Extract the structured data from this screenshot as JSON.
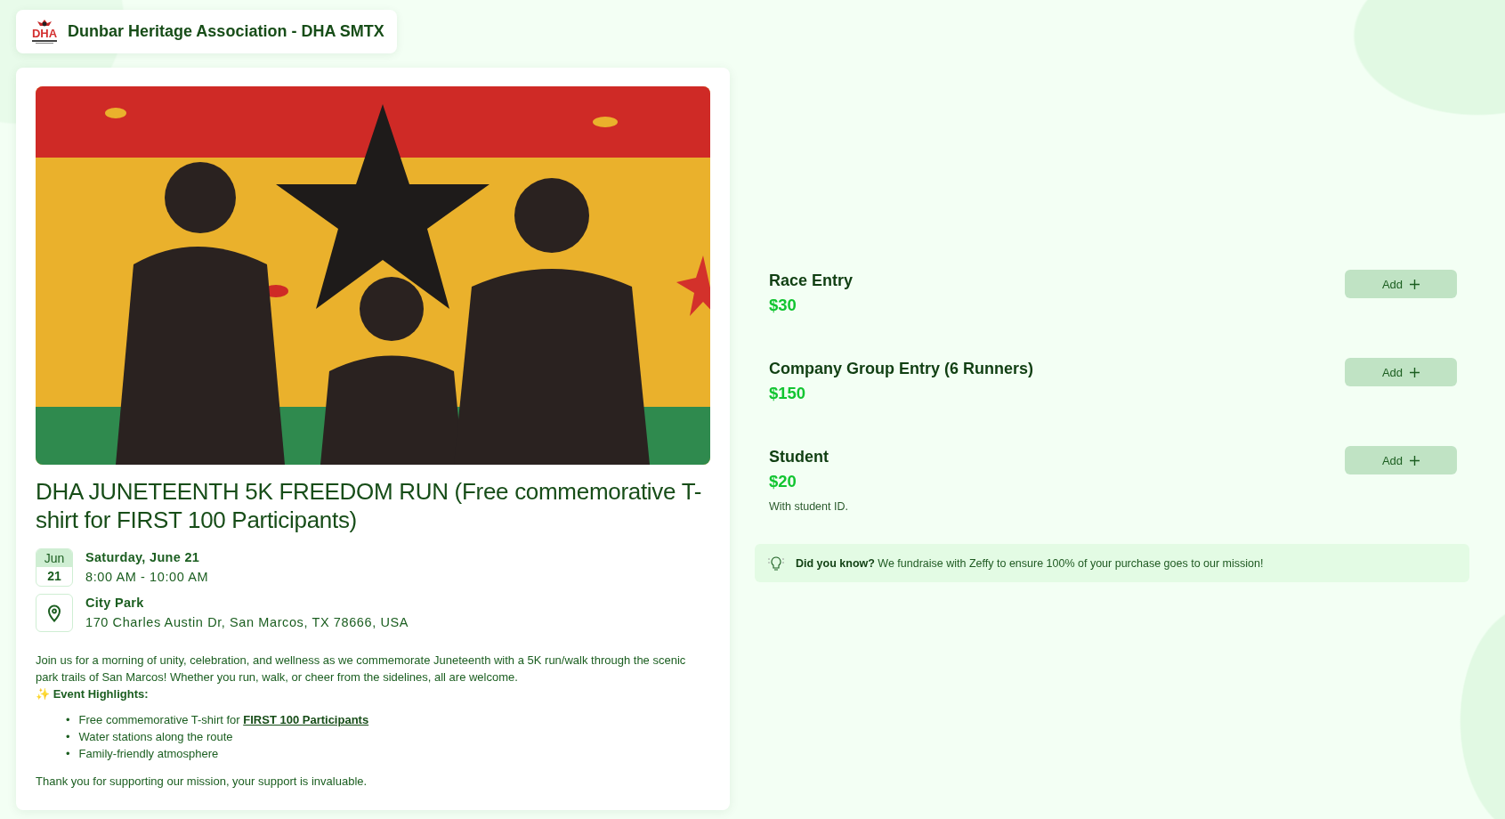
{
  "organization": {
    "name": "Dunbar Heritage Association - DHA SMTX",
    "logo_text": "DHA"
  },
  "event": {
    "title": "DHA JUNETEENTH 5K FREEDOM RUN (Free commemorative T-shirt for FIRST 100 Participants)",
    "date": {
      "month": "Jun",
      "day": "21",
      "day_label": "Saturday, June 21",
      "time": "8:00 AM - 10:00 AM"
    },
    "location": {
      "name": "City Park",
      "address": "170 Charles Austin Dr, San Marcos, TX 78666, USA"
    },
    "intro": "Join us for a morning of unity, celebration, and wellness as we commemorate Juneteenth with a 5K run/walk through the scenic park trails of San Marcos! Whether you run, walk, or cheer from the sidelines, all are welcome.",
    "highlights_heading": "✨ **Event Highlights:**",
    "highlights": [
      {
        "marker": "•",
        "text": "Free commemorative T-shirt for ",
        "link": "FIRST 100 Participants"
      },
      {
        "marker": "•",
        "text": "Water stations along the route"
      },
      {
        "marker": "•",
        "text": "Family-friendly atmosphere"
      }
    ],
    "closing": "Thank you for supporting our mission, your support is invaluable."
  },
  "tickets": [
    {
      "name": "Race Entry",
      "price": "$30",
      "button": "Add"
    },
    {
      "name": "Company Group Entry (6 Runners)",
      "price": "$150",
      "button": "Add"
    },
    {
      "name": "Student",
      "price": "$20",
      "note": "With student ID.",
      "button": "Add"
    }
  ],
  "info_banner": {
    "text": "**Did you know?** We fundraise with Zeffy to ensure 100% of your purchase goes to our mission!"
  }
}
